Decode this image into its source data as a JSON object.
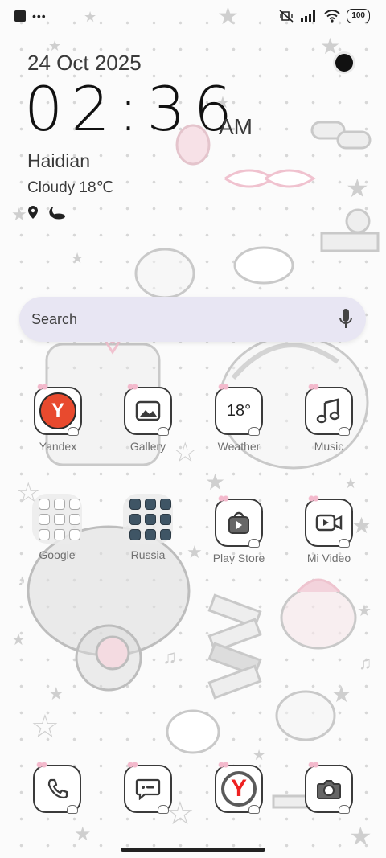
{
  "status": {
    "battery": "100"
  },
  "lockinfo": {
    "date": "24 Oct 2025",
    "time": "02:36",
    "ampm": "AM",
    "city": "Haidian",
    "weather": "Cloudy  18℃"
  },
  "search": {
    "label": "Search"
  },
  "apps": {
    "yandex": {
      "label": "Yandex",
      "icon": "yandex-icon"
    },
    "gallery": {
      "label": "Gallery",
      "icon": "gallery-icon"
    },
    "weather": {
      "label": "Weather",
      "icon": "weather-icon",
      "temp": "18°"
    },
    "music": {
      "label": "Music",
      "icon": "music-note-icon"
    },
    "google": {
      "label": "Google",
      "icon": "folder-icon"
    },
    "russia": {
      "label": "Russia",
      "icon": "folder-icon"
    },
    "playstore": {
      "label": "Play Store",
      "icon": "play-store-icon"
    },
    "mivideo": {
      "label": "Mi Video",
      "icon": "video-camera-icon"
    }
  },
  "dock": {
    "phone": {
      "icon": "phone-icon"
    },
    "messages": {
      "icon": "message-icon"
    },
    "browser": {
      "icon": "yandex-browser-icon"
    },
    "camera": {
      "icon": "camera-icon"
    }
  },
  "colors": {
    "yandex_red": "#e84a2e",
    "search_bg": "#e8e6f3",
    "icon_border": "#3a3a3a",
    "accent_pink": "#f3b9cc"
  }
}
